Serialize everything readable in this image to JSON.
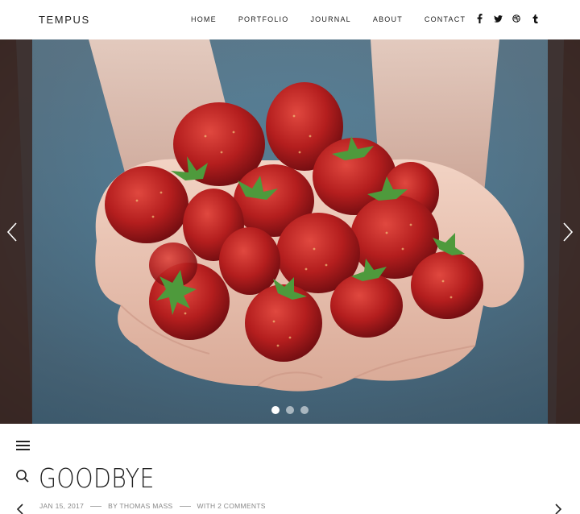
{
  "site": {
    "logo": "TEMPUS"
  },
  "nav": {
    "items": [
      {
        "label": "HOME"
      },
      {
        "label": "PORTFOLIO"
      },
      {
        "label": "JOURNAL"
      },
      {
        "label": "ABOUT"
      },
      {
        "label": "CONTACT"
      }
    ]
  },
  "social": {
    "icons": [
      "facebook-icon",
      "twitter-icon",
      "dribbble-icon",
      "tumblr-icon"
    ]
  },
  "hero": {
    "slides_total": 3,
    "active_slide": 1,
    "image": "strawberries-in-hands"
  },
  "post": {
    "title": "GOODBYE",
    "date": "JAN 15, 2017",
    "author": "BY THOMAS MASS",
    "comments": "WITH 2 COMMENTS"
  },
  "colors": {
    "text": "#222222",
    "meta": "#888888",
    "background": "#ffffff"
  }
}
